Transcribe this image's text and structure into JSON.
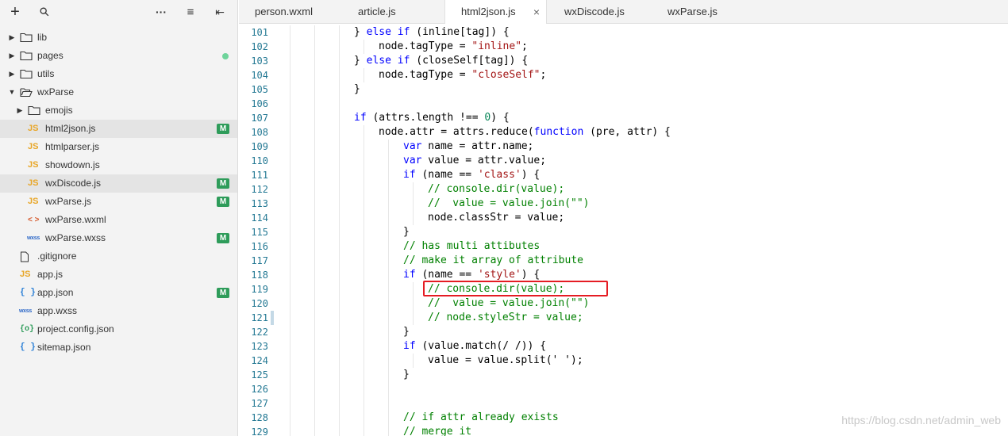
{
  "sidebar": {
    "toolbar": [
      {
        "name": "add-icon",
        "glyph": "+"
      },
      {
        "name": "search-icon",
        "glyph": "⚲"
      },
      {
        "name": "more-icon",
        "glyph": "···"
      },
      {
        "name": "outline-icon",
        "glyph": "≡"
      },
      {
        "name": "collapse-sidebar-icon",
        "glyph": "⇤"
      }
    ],
    "tree": [
      {
        "label": "lib",
        "type": "folder",
        "open": false,
        "depth": 0
      },
      {
        "label": "pages",
        "type": "folder",
        "open": false,
        "depth": 0,
        "dot": true
      },
      {
        "label": "utils",
        "type": "folder",
        "open": false,
        "depth": 0
      },
      {
        "label": "wxParse",
        "type": "folder",
        "open": true,
        "depth": 0
      },
      {
        "label": "emojis",
        "type": "folder",
        "open": false,
        "depth": 1
      },
      {
        "label": "html2json.js",
        "type": "js",
        "depth": 1,
        "badge": "M",
        "selected": true
      },
      {
        "label": "htmlparser.js",
        "type": "js",
        "depth": 1
      },
      {
        "label": "showdown.js",
        "type": "js",
        "depth": 1
      },
      {
        "label": "wxDiscode.js",
        "type": "js",
        "depth": 1,
        "badge": "M",
        "selected": true
      },
      {
        "label": "wxParse.js",
        "type": "js",
        "depth": 1,
        "badge": "M"
      },
      {
        "label": "wxParse.wxml",
        "type": "wxml",
        "depth": 1
      },
      {
        "label": "wxParse.wxss",
        "type": "wxss",
        "depth": 1,
        "badge": "M"
      },
      {
        "label": ".gitignore",
        "type": "file",
        "depth": 0
      },
      {
        "label": "app.js",
        "type": "js",
        "depth": 0
      },
      {
        "label": "app.json",
        "type": "json",
        "depth": 0,
        "badge": "M"
      },
      {
        "label": "app.wxss",
        "type": "wxss",
        "depth": 0
      },
      {
        "label": "project.config.json",
        "type": "config",
        "depth": 0
      },
      {
        "label": "sitemap.json",
        "type": "json",
        "depth": 0
      }
    ]
  },
  "tabs": [
    {
      "label": "person.wxml",
      "active": false
    },
    {
      "label": "article.js",
      "active": false
    },
    {
      "label": "html2json.js",
      "active": true,
      "close": "×"
    },
    {
      "label": "wxDiscode.js",
      "active": false
    },
    {
      "label": "wxParse.js",
      "active": false
    }
  ],
  "editor": {
    "lines": [
      {
        "n": "101",
        "indent": 3,
        "tokens": [
          [
            "p",
            "} "
          ],
          [
            "kw",
            "else if"
          ],
          [
            "p",
            " (inline[tag]) {"
          ]
        ]
      },
      {
        "n": "102",
        "indent": 4,
        "tokens": [
          [
            "p",
            "node.tagType = "
          ],
          [
            "str",
            "\"inline\""
          ],
          [
            "p",
            ";"
          ]
        ]
      },
      {
        "n": "103",
        "indent": 3,
        "tokens": [
          [
            "p",
            "} "
          ],
          [
            "kw",
            "else if"
          ],
          [
            "p",
            " (closeSelf[tag]) {"
          ]
        ]
      },
      {
        "n": "104",
        "indent": 4,
        "tokens": [
          [
            "p",
            "node.tagType = "
          ],
          [
            "str",
            "\"closeSelf\""
          ],
          [
            "p",
            ";"
          ]
        ]
      },
      {
        "n": "105",
        "indent": 3,
        "tokens": [
          [
            "p",
            "}"
          ]
        ]
      },
      {
        "n": "106",
        "indent": 3,
        "tokens": []
      },
      {
        "n": "107",
        "indent": 3,
        "tokens": [
          [
            "kw",
            "if"
          ],
          [
            "p",
            " (attrs.length !== "
          ],
          [
            "num",
            "0"
          ],
          [
            "p",
            ") {"
          ]
        ]
      },
      {
        "n": "108",
        "indent": 4,
        "tokens": [
          [
            "p",
            "node.attr = attrs.reduce("
          ],
          [
            "kw",
            "function"
          ],
          [
            "p",
            " (pre, attr) {"
          ]
        ]
      },
      {
        "n": "109",
        "indent": 5,
        "tokens": [
          [
            "kw",
            "var"
          ],
          [
            "p",
            " name = attr.name;"
          ]
        ]
      },
      {
        "n": "110",
        "indent": 5,
        "tokens": [
          [
            "kw",
            "var"
          ],
          [
            "p",
            " value = attr.value;"
          ]
        ]
      },
      {
        "n": "111",
        "indent": 5,
        "tokens": [
          [
            "kw",
            "if"
          ],
          [
            "p",
            " (name == "
          ],
          [
            "str",
            "'class'"
          ],
          [
            "p",
            ") {"
          ]
        ]
      },
      {
        "n": "112",
        "indent": 6,
        "tokens": [
          [
            "cm",
            "// console.dir(value);"
          ]
        ]
      },
      {
        "n": "113",
        "indent": 6,
        "tokens": [
          [
            "cm",
            "//  value = value.join(\"\")"
          ]
        ]
      },
      {
        "n": "114",
        "indent": 6,
        "tokens": [
          [
            "p",
            "node.classStr = value;"
          ]
        ]
      },
      {
        "n": "115",
        "indent": 5,
        "tokens": [
          [
            "p",
            "}"
          ]
        ]
      },
      {
        "n": "116",
        "indent": 5,
        "tokens": [
          [
            "cm",
            "// has multi attibutes"
          ]
        ]
      },
      {
        "n": "117",
        "indent": 5,
        "tokens": [
          [
            "cm",
            "// make it array of attribute"
          ]
        ]
      },
      {
        "n": "118",
        "indent": 5,
        "tokens": [
          [
            "kw",
            "if"
          ],
          [
            "p",
            " (name == "
          ],
          [
            "str",
            "'style'"
          ],
          [
            "p",
            ") {"
          ]
        ]
      },
      {
        "n": "119",
        "indent": 6,
        "tokens": [
          [
            "cm",
            "// console.dir(value);"
          ]
        ]
      },
      {
        "n": "120",
        "indent": 6,
        "tokens": [
          [
            "cm",
            "//  value = value.join(\"\")"
          ]
        ]
      },
      {
        "n": "121",
        "indent": 6,
        "tokens": [
          [
            "cm",
            "// node.styleStr = value;"
          ]
        ]
      },
      {
        "n": "122",
        "indent": 5,
        "tokens": [
          [
            "p",
            "}"
          ]
        ]
      },
      {
        "n": "123",
        "indent": 5,
        "tokens": [
          [
            "kw",
            "if"
          ],
          [
            "p",
            " (value.match(/ /)) {"
          ]
        ]
      },
      {
        "n": "124",
        "indent": 6,
        "tokens": [
          [
            "p",
            "value = value.split(' ');"
          ]
        ]
      },
      {
        "n": "125",
        "indent": 5,
        "tokens": [
          [
            "p",
            "}"
          ]
        ]
      },
      {
        "n": "126",
        "indent": 5,
        "tokens": []
      },
      {
        "n": "127",
        "indent": 5,
        "tokens": []
      },
      {
        "n": "128",
        "indent": 5,
        "tokens": [
          [
            "cm",
            "// if attr already exists"
          ]
        ]
      },
      {
        "n": "129",
        "indent": 5,
        "tokens": [
          [
            "cm",
            "// merge it"
          ]
        ]
      }
    ]
  },
  "watermark": "https://blog.csdn.net/admin_web",
  "colors": {
    "keyword": "#0000ff",
    "string": "#a31515",
    "comment": "#008000",
    "line_number": "#237893",
    "badge": "#2e9c5a",
    "highlight_box": "#e51c23"
  }
}
